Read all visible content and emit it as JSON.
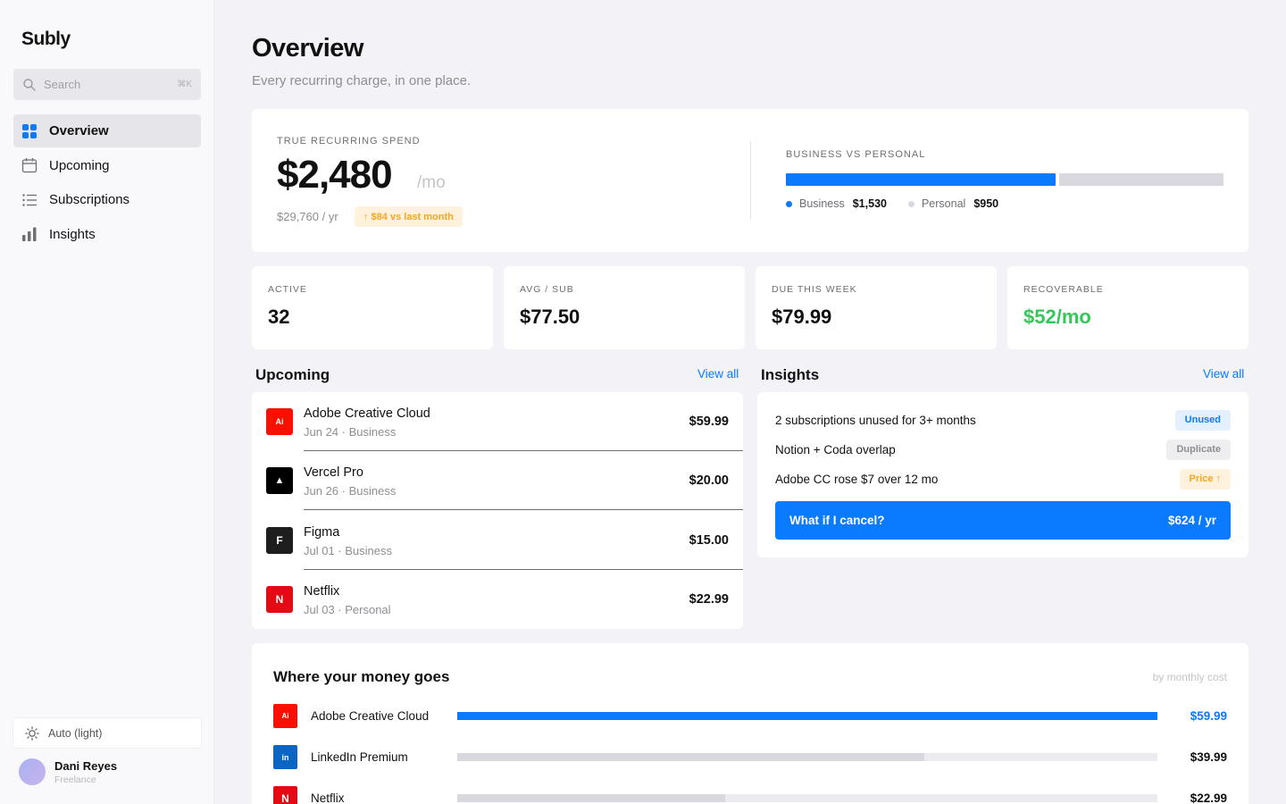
{
  "app": {
    "name": "Subly"
  },
  "search": {
    "placeholder": "Search",
    "shortcut": "⌘K"
  },
  "nav": [
    {
      "label": "Overview",
      "icon": "grid-icon",
      "active": true
    },
    {
      "label": "Upcoming",
      "icon": "calendar-icon",
      "active": false
    },
    {
      "label": "Subscriptions",
      "icon": "list-icon",
      "active": false
    },
    {
      "label": "Insights",
      "icon": "bar-chart-icon",
      "active": false
    }
  ],
  "theme": {
    "label": "Auto (light)"
  },
  "user": {
    "name": "Dani Reyes",
    "role": "Freelance"
  },
  "page": {
    "title": "Overview",
    "subtitle": "Every recurring charge, in one place."
  },
  "spend": {
    "label": "TRUE RECURRING SPEND",
    "amount": "$2,480",
    "period": "/mo",
    "yearly": "$29,760 / yr",
    "delta": "↑ $84 vs last month"
  },
  "split": {
    "label": "BUSINESS VS PERSONAL",
    "business_fraction": 0.617,
    "business": {
      "label": "Business",
      "value": "$1,530",
      "color": "#0a7aff"
    },
    "personal": {
      "label": "Personal",
      "value": "$950",
      "color": "#d8d8de"
    }
  },
  "stats": [
    {
      "label": "ACTIVE",
      "value": "32"
    },
    {
      "label": "AVG / SUB",
      "value": "$77.50"
    },
    {
      "label": "DUE THIS WEEK",
      "value": "$79.99"
    },
    {
      "label": "RECOVERABLE",
      "value": "$52/mo",
      "color": "#34c759"
    }
  ],
  "upcoming": {
    "title": "Upcoming",
    "view_all": "View all",
    "items": [
      {
        "logo_text": "Ai",
        "logo_color": "#fa0f00",
        "name": "Adobe Creative Cloud",
        "meta": "Jun 24 · Business",
        "amount": "$59.99"
      },
      {
        "logo_text": "▲",
        "logo_color": "#000000",
        "name": "Vercel Pro",
        "meta": "Jun 26 · Business",
        "amount": "$20.00"
      },
      {
        "logo_text": "F",
        "logo_color": "#1e1e1e",
        "name": "Figma",
        "meta": "Jul 01 · Business",
        "amount": "$15.00"
      },
      {
        "logo_text": "N",
        "logo_color": "#e50914",
        "name": "Netflix",
        "meta": "Jul 03 · Personal",
        "amount": "$22.99"
      }
    ]
  },
  "insights": {
    "title": "Insights",
    "view_all": "View all",
    "items": [
      {
        "text": "2 subscriptions unused for 3+ months",
        "tag": "Unused",
        "tag_style": "blue"
      },
      {
        "text": "Notion + Coda overlap",
        "tag": "Duplicate",
        "tag_style": "gray"
      },
      {
        "text": "Adobe CC rose $7 over 12 mo",
        "tag": "Price ↑",
        "tag_style": "orange"
      }
    ],
    "cta": {
      "label": "What if I cancel?",
      "value": "$624 / yr"
    }
  },
  "money": {
    "title": "Where your money goes",
    "subtitle": "by monthly cost",
    "items": [
      {
        "logo_text": "Ai",
        "logo_color": "#fa0f00",
        "name": "Adobe Creative Cloud",
        "amount": "$59.99",
        "value": 59.99,
        "bar_color": "#0a7aff",
        "amount_color": "#0a7aff"
      },
      {
        "logo_text": "in",
        "logo_color": "#0a66c2",
        "name": "LinkedIn Premium",
        "amount": "$39.99",
        "value": 39.99,
        "bar_color": "#d8d8de",
        "amount_color": "#111111"
      },
      {
        "logo_text": "N",
        "logo_color": "#e50914",
        "name": "Netflix",
        "amount": "$22.99",
        "value": 22.99,
        "bar_color": "#d8d8de",
        "amount_color": "#111111"
      }
    ],
    "max_value": 59.99
  }
}
